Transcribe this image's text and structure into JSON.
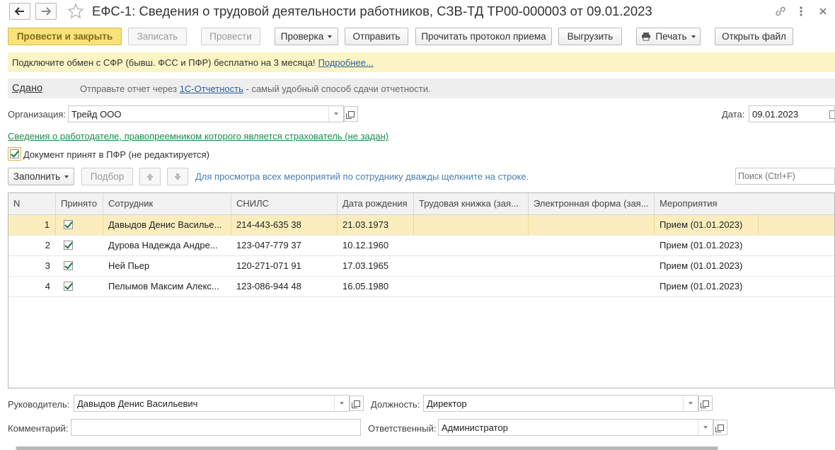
{
  "window": {
    "title": "ЕФС-1: Сведения о трудовой деятельности работников, СЗВ-ТД ТР00-000003 от 09.01.2023"
  },
  "toolbar": {
    "post_close": "Провести и закрыть",
    "save": "Записать",
    "post": "Провести",
    "check": "Проверка",
    "send": "Отправить",
    "read_protocol": "Прочитать протокол приема",
    "export": "Выгрузить",
    "print": "Печать",
    "open_file": "Открыть файл"
  },
  "banner": {
    "text": "Подключите обмен с СФР (бывш. ФСС и ПФР) бесплатно на 3 месяца!",
    "link": "Подробнее..."
  },
  "status": {
    "label": "Сдано",
    "text_before": "Отправьте отчет через",
    "link": "1С-Отчетность",
    "text_after": "- самый удобный способ сдачи отчетности."
  },
  "form": {
    "org_label": "Организация:",
    "org_value": "Трейд ООО",
    "date_label": "Дата:",
    "date_value": "09.01.2023",
    "employer_link": "Сведения о работодателе, правопреемником которого является страхователь (не задан)",
    "accepted_label": "Документ принят в ПФР (не редактируется)"
  },
  "table_toolbar": {
    "fill": "Заполнить",
    "select": "Подбор",
    "hint": "Для просмотра всех мероприятий по сотруднику дважды щелкните на строке.",
    "search_placeholder": "Поиск (Ctrl+F)"
  },
  "table": {
    "columns": [
      "N",
      "Принято",
      "Сотрудник",
      "СНИЛС",
      "Дата рождения",
      "Трудовая книжка (зая...",
      "Электронная форма (зая...",
      "Мероприятия"
    ],
    "rows": [
      {
        "n": "1",
        "accepted": true,
        "employee": "Давыдов Денис Василье...",
        "snils": "214-443-635 38",
        "birth": "21.03.1973",
        "book": "",
        "eform": "",
        "events": "Прием (01.01.2023)"
      },
      {
        "n": "2",
        "accepted": true,
        "employee": "Дурова Надежда Андре...",
        "snils": "123-047-779 37",
        "birth": "10.12.1960",
        "book": "",
        "eform": "",
        "events": "Прием (01.01.2023)"
      },
      {
        "n": "3",
        "accepted": true,
        "employee": "Ней Пьер",
        "snils": "120-271-071 91",
        "birth": "17.03.1965",
        "book": "",
        "eform": "",
        "events": "Прием (01.01.2023)"
      },
      {
        "n": "4",
        "accepted": true,
        "employee": "Пелымов Максим Алекс...",
        "snils": "123-086-944 48",
        "birth": "16.05.1980",
        "book": "",
        "eform": "",
        "events": "Прием (01.01.2023)"
      }
    ]
  },
  "footer": {
    "head_label": "Руководитель:",
    "head_value": "Давыдов Денис Васильевич",
    "position_label": "Должность:",
    "position_value": "Директор",
    "comment_label": "Комментарий:",
    "comment_value": "",
    "responsible_label": "Ответственный:",
    "responsible_value": "Администратор"
  },
  "icons": [
    "back-arrow-icon",
    "forward-arrow-icon",
    "star-icon",
    "link-icon",
    "more-icon",
    "close-icon",
    "printer-icon",
    "up-arrow-icon",
    "down-arrow-icon",
    "calendar-icon",
    "open-icon"
  ]
}
